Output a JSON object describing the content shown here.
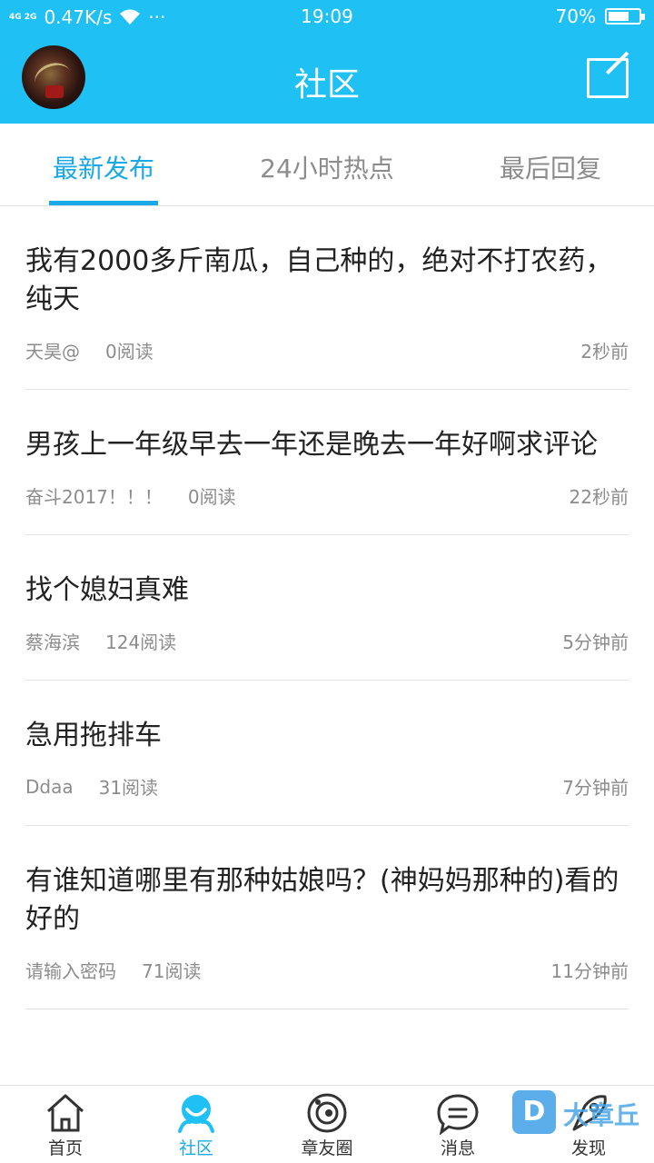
{
  "status_bar": {
    "signal": "4G 2G",
    "speed": "0.47K/s",
    "dots": "···",
    "time": "19:09",
    "battery": "70%",
    "battery_level": 0.7
  },
  "header": {
    "title": "社区"
  },
  "tabs": [
    {
      "label": "最新发布",
      "active": true
    },
    {
      "label": "24小时热点",
      "active": false
    },
    {
      "label": "最后回复",
      "active": false
    }
  ],
  "posts": [
    {
      "title": "我有2000多斤南瓜，自己种的，绝对不打农药，纯天",
      "author": "天昊@",
      "reads": "0阅读",
      "time": "2秒前"
    },
    {
      "title": "男孩上一年级早去一年还是晚去一年好啊求评论",
      "author": "奋斗2017！！！",
      "reads": "0阅读",
      "time": "22秒前"
    },
    {
      "title": "找个媳妇真难",
      "author": "蔡海滨",
      "reads": "124阅读",
      "time": "5分钟前"
    },
    {
      "title": "急用拖排车",
      "author": "Ddaa",
      "reads": "31阅读",
      "time": "7分钟前"
    },
    {
      "title": "有谁知道哪里有那种姑娘吗？(神妈妈那种的)看的好的",
      "author": "请输入密码",
      "reads": "71阅读",
      "time": "11分钟前"
    }
  ],
  "bottom_nav": [
    {
      "label": "首页",
      "icon": "home-icon"
    },
    {
      "label": "社区",
      "icon": "community-icon",
      "active": true
    },
    {
      "label": "章友圈",
      "icon": "circle-icon"
    },
    {
      "label": "消息",
      "icon": "message-icon"
    },
    {
      "label": "发现",
      "icon": "discover-icon"
    }
  ],
  "watermark": {
    "badge": "D",
    "text": "大章丘"
  },
  "colors": {
    "brand": "#1fc1f5",
    "accent": "#19a9e6"
  }
}
